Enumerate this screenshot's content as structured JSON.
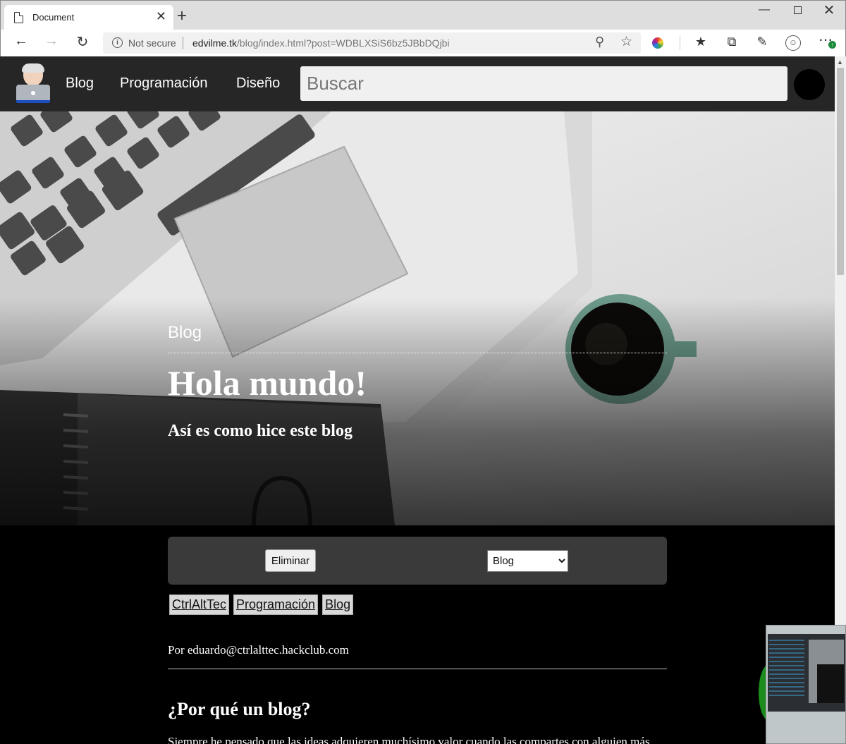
{
  "browser": {
    "tab_title": "Document",
    "tab_close": "✕",
    "new_tab": "+",
    "not_secure": "Not secure",
    "url_host": "edvilme.tk",
    "url_path": "/blog/index.html?post=WDBLXSiS6bz5JBbDQjbi",
    "window_controls": {
      "minimize": "—",
      "close": "✕"
    },
    "icons": [
      "back-arrow-icon",
      "forward-arrow-icon",
      "reload-icon",
      "info-icon",
      "zoom-icon",
      "star-icon",
      "color-wheel-icon",
      "favorites-icon",
      "collections-icon",
      "feedback-icon",
      "profile-icon",
      "more-icon"
    ]
  },
  "site": {
    "nav": [
      "Blog",
      "Programación",
      "Diseño"
    ],
    "search_placeholder": "Buscar"
  },
  "hero": {
    "category": "Blog",
    "title": "Hola mundo!",
    "subtitle": "Así es como hice este blog"
  },
  "actions": {
    "delete_label": "Eliminar",
    "category_selected": "Blog"
  },
  "tags": [
    "CtrlAltTec",
    "Programación",
    "Blog"
  ],
  "post": {
    "author": "Por eduardo@ctrlalttec.hackclub.com",
    "heading": "¿Por qué un blog?",
    "body_first_line": "Siempre he pensado que las ideas adquieren muchísimo valor cuando las compartes con alguien más"
  },
  "colors": {
    "nav_bg": "#262626",
    "page_bg": "#000000",
    "panel_bg": "#3a3a3a",
    "accent_green": "#1b8a3a"
  }
}
